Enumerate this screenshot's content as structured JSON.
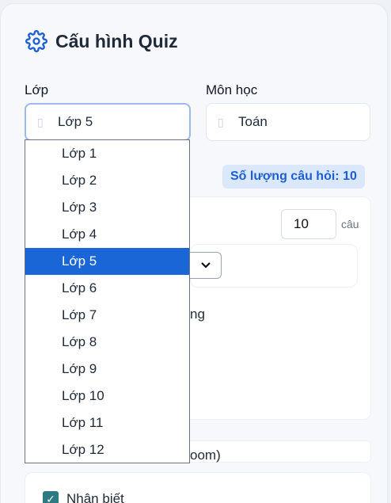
{
  "page": {
    "title": "Cấu hình Quiz",
    "title_icon": "gear-icon",
    "accent_color": "#1d5fd1"
  },
  "fields": {
    "class_label": "Lớp",
    "class_value": "Lớp 5",
    "subject_label": "Môn học",
    "subject_value": "Toán"
  },
  "question_count": {
    "badge": "Số lượng câu hỏi: 10",
    "input_value": "10",
    "unit": "câu"
  },
  "partial_texts": {
    "fragment_ng": "ng",
    "fragment_bloom": "oom)"
  },
  "bloom_levels": [
    {
      "label": "Nhận biết",
      "checked": true
    }
  ],
  "class_dropdown": {
    "options": [
      "Lớp 1",
      "Lớp 2",
      "Lớp 3",
      "Lớp 4",
      "Lớp 5",
      "Lớp 6",
      "Lớp 7",
      "Lớp 8",
      "Lớp 9",
      "Lớp 10",
      "Lớp 11",
      "Lớp 12"
    ],
    "selected": "Lớp 5"
  }
}
